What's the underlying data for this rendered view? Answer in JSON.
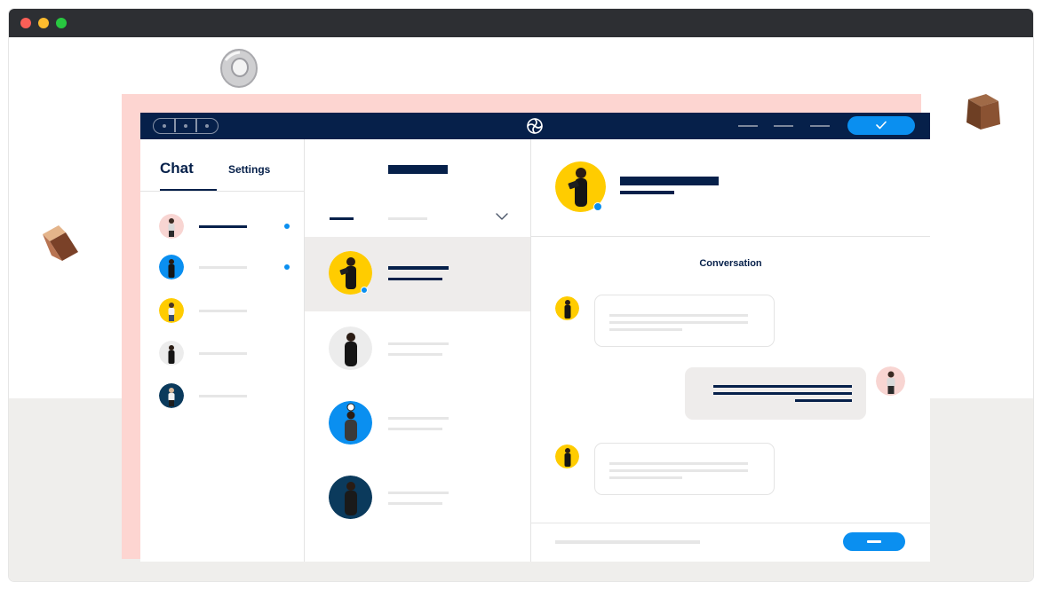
{
  "app": {
    "chat_tab_label": "Chat",
    "settings_tab_label": "Settings",
    "conversation_title": "Conversation"
  },
  "colors": {
    "navy": "#06204a",
    "accent_blue": "#0a8ff0",
    "pink_background": "#fdd5d1",
    "active_row": "#eeeceb",
    "avatar_yellow": "#ffcc00",
    "avatar_blue": "#0a8ff0",
    "avatar_pink": "#f8d5d2",
    "avatar_grey": "#ececec",
    "avatar_dark_blue": "#0b3a5c"
  },
  "icons": {
    "logo": "sync-logo-icon",
    "confirm": "check-icon",
    "dropdown": "chevron-down-icon"
  }
}
